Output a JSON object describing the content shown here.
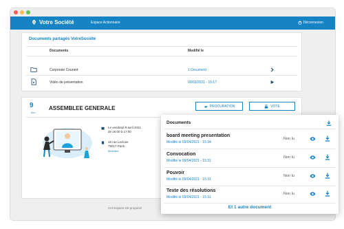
{
  "navbar": {
    "brand": "Votre Société",
    "link": "Espace Actionnaire",
    "logout": "Déconnexion"
  },
  "shared_docs": {
    "title": "Documents partagés VotreSociété",
    "col_documents": "Documents",
    "col_modified": "Modifié le",
    "rows": [
      {
        "name": "Corporate Courant",
        "meta": "1 Document",
        "icon": "folder-icon",
        "action": "chevron-right-icon"
      },
      {
        "name": "Vidéo de présentation",
        "meta": "09/03/2021 - 15:17",
        "icon": "file-video-icon",
        "action": "play-icon"
      }
    ]
  },
  "assembly": {
    "day": "9",
    "month": "Avr.",
    "title": "ASSEMBLEE GENERALE",
    "proxy_button": "PROCURATION",
    "vote_button": "VOTE",
    "date_line1": "Le vendredi 9 avril 2021",
    "date_line2": "de 16:00 à 17:00",
    "address_line1": "16 rue Lecluse",
    "address_line2": "75017 Paris",
    "itinerary": "Itinéraire"
  },
  "footer_note": "Cet Espace est propulsé",
  "popup": {
    "title": "Documents",
    "more_link": "Et 1 autre document",
    "rows": [
      {
        "name": "board meeting presentation",
        "modified": "Modifié le 09/04/2021 - 15:34",
        "status": "Non lu"
      },
      {
        "name": "Convocation",
        "modified": "Modifié le 09/04/2021 - 15:31",
        "status": "Non lu"
      },
      {
        "name": "Pouvoir",
        "modified": "Modifié le 09/04/2021 - 15:31",
        "status": "Non lu"
      },
      {
        "name": "Texte des résolutions",
        "modified": "Modifié le 09/04/2021 - 15:31",
        "status": "Non lu"
      }
    ]
  },
  "colors": {
    "primary": "#1683c4",
    "background": "#efefef",
    "card": "#ffffff"
  }
}
